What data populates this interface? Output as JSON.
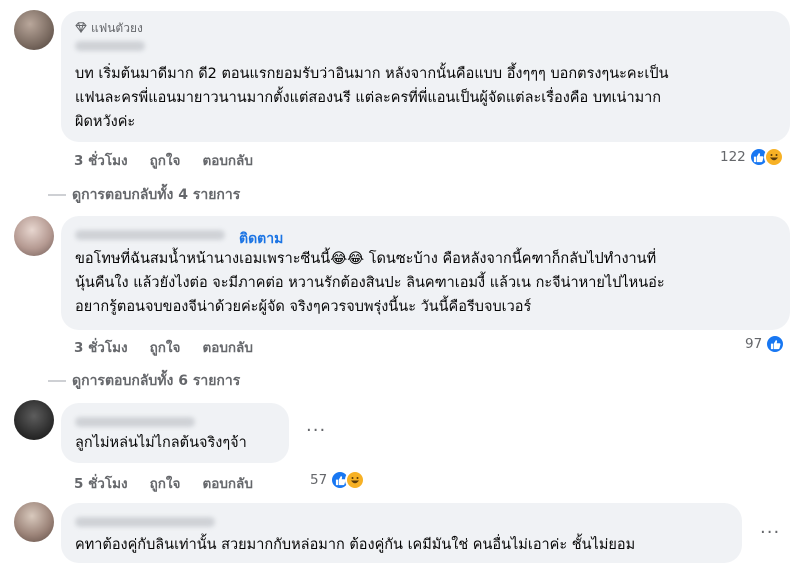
{
  "comments": [
    {
      "badge": "แฟนตัวยง",
      "text": "บท เริ่มต้นมาดีมาก ดี2 ตอนแรกยอมรับว่าอินมาก หลังจากนั้นคือแบบ อึ้งๆๆๆ บอกตรงๆนะคะเป็น\nแฟนละครพี่แอนมายาวนานมากตั้งแต่สองนรี แต่ละครที่พี่แอนเป็นผู้จัดแต่ละเรื่องคือ บทเน่ามาก\nผิดหวังค่ะ",
      "time": "3 ชั่วโมง",
      "like": "ถูกใจ",
      "reply": "ตอบกลับ",
      "reaction_count": "122",
      "view_replies": "ดูการตอบกลับทั้ง 4 รายการ"
    },
    {
      "follow": "ติดตาม",
      "text": "ขอโทษที่ฉันสมน้ำหน้านางเอมเพราะซีนนี้😂😂 โดนซะบ้าง คือหลังจากนี้คฑาก็กลับไปทำงานที่\nนุ้นคืนใง แล้วยังไงต่อ จะมีภาคต่อ หวานรักต้องสินปะ ลินคฑาเอมงี้ แล้วเน กะจีน่าหายไปไหนอ่ะ\nอยากรู้ตอนจบของจีน่าด้วยค่ะผู้จัด จริงๆควรจบพรุ่งนี้นะ วันนี้คือรีบจบเวอร์",
      "time": "3 ชั่วโมง",
      "like": "ถูกใจ",
      "reply": "ตอบกลับ",
      "reaction_count": "97",
      "view_replies": "ดูการตอบกลับทั้ง 6 รายการ"
    },
    {
      "text": "ลูกไม่หล่นไม่ไกลต้นจริงๆจ้า",
      "time": "5 ชั่วโมง",
      "like": "ถูกใจ",
      "reply": "ตอบกลับ",
      "reaction_count": "57",
      "more": "···"
    },
    {
      "text": "คทาต้องคู่กับลินเท่านั้น สวยมากกับหล่อมาก ต้องคู่กัน เคมีมันใช่ คนอื่นไม่เอาค่ะ ชั้นไม่ยอม",
      "more": "···"
    }
  ],
  "icons": {
    "fan_badge": "diamond-icon",
    "like_reaction": "like-reaction-icon",
    "haha_reaction": "haha-reaction-icon",
    "more": "more-options-icon"
  },
  "colors": {
    "bubble": "#f0f2f5",
    "meta_text": "#65676b",
    "follow": "#1b74e4",
    "like": "#1877f2",
    "haha": "#f7b125"
  }
}
